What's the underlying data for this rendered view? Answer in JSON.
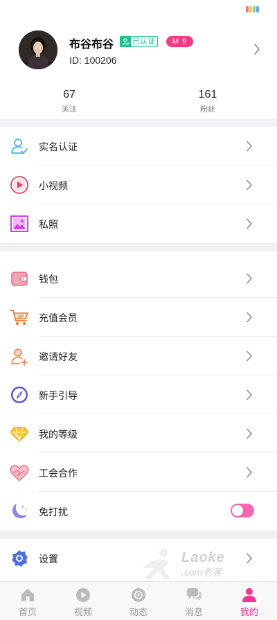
{
  "status_bar": {
    "colors": [
      "#f27a7a",
      "#f5c84c",
      "#8fd47a",
      "#6aa8f0"
    ]
  },
  "profile": {
    "name": "布谷布谷",
    "verified_label": "已认证",
    "level_label": "M 9",
    "id_label": "ID: 100206"
  },
  "stats": {
    "following": {
      "value": "67",
      "label": "关注"
    },
    "fans": {
      "value": "161",
      "label": "粉丝"
    }
  },
  "menu_sections": [
    [
      {
        "label": "实名认证",
        "icon": "id-verify-icon"
      },
      {
        "label": "小视频",
        "icon": "play-circle-icon"
      },
      {
        "label": "私照",
        "icon": "photo-icon"
      }
    ],
    [
      {
        "label": "钱包",
        "icon": "wallet-icon"
      },
      {
        "label": "充值会员",
        "icon": "vip-cart-icon"
      },
      {
        "label": "邀请好友",
        "icon": "invite-user-icon"
      },
      {
        "label": "新手引导",
        "icon": "compass-icon"
      },
      {
        "label": "我的等级",
        "icon": "diamond-icon"
      },
      {
        "label": "工会合作",
        "icon": "handshake-heart-icon"
      },
      {
        "label": "免打扰",
        "icon": "moon-icon",
        "toggle_on": true
      }
    ],
    [
      {
        "label": "设置",
        "icon": "gear-icon"
      }
    ]
  ],
  "watermark": {
    "brand": "Laoke",
    "domain": ".com老客"
  },
  "tabbar": {
    "tabs": [
      {
        "label": "首页",
        "icon": "home-icon",
        "active": false
      },
      {
        "label": "视频",
        "icon": "video-play-icon",
        "active": false
      },
      {
        "label": "动态",
        "icon": "moments-icon",
        "active": false
      },
      {
        "label": "消息",
        "icon": "chat-bubbles-icon",
        "active": false
      },
      {
        "label": "我的",
        "icon": "person-icon",
        "active": true
      }
    ],
    "active_color": "#f0368e",
    "inactive_color": "#bbbbbb"
  },
  "colors": {
    "accent_pink": "#f53c83",
    "verified_green": "#21c08f",
    "section_gap": "#f1f1f5"
  }
}
